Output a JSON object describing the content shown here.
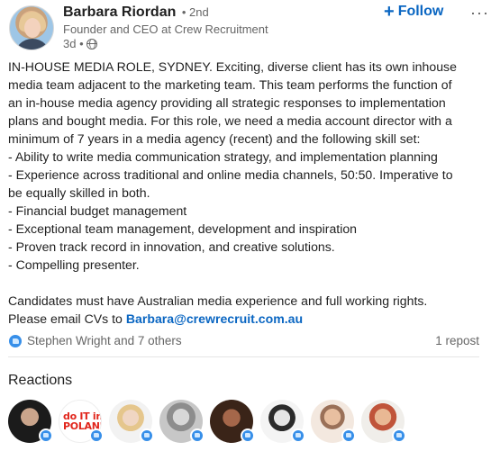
{
  "author": {
    "name": "Barbara Riordan",
    "degree": "• 2nd",
    "headline": "Founder and CEO at Crew Recruitment",
    "time": "3d •",
    "visibility_icon": "globe-icon"
  },
  "actions": {
    "follow_label": "Follow",
    "follow_icon": "+",
    "more_label": "···"
  },
  "post": {
    "lines": [
      "IN-HOUSE MEDIA ROLE, SYDNEY. Exciting, diverse client has its own inhouse",
      "media team adjacent to the marketing team. This team performs the function of",
      "an in-house media agency providing all strategic responses to implementation",
      "plans and bought media. For this role, we need a media account director with a",
      "minimum of 7 years in a media agency (recent) and the following skill set:",
      "- Ability to write media communication strategy, and implementation planning",
      "- Experience across traditional and online media channels, 50:50. Imperative to",
      "be equally skilled in both.",
      "- Financial budget management",
      "- Exceptional team management, development and inspiration",
      "- Proven track record in innovation, and creative solutions.",
      "- Compelling presenter."
    ],
    "closing_line_1": "Candidates must have Australian media experience and full working rights.",
    "closing_line_2_prefix": "Please email CVs to ",
    "email": "Barbara@crewrecruit.com.au"
  },
  "social": {
    "reaction_icon": "like-icon",
    "reactors_summary": "Stephen Wright and 7 others",
    "reposts": "1 repost"
  },
  "reactions": {
    "title": "Reactions",
    "logo_text_line1": "do IT in",
    "logo_text_line2": "POLAND"
  },
  "colors": {
    "accent": "#0a66c2",
    "like": "#378fe9",
    "muted": "#666666"
  }
}
